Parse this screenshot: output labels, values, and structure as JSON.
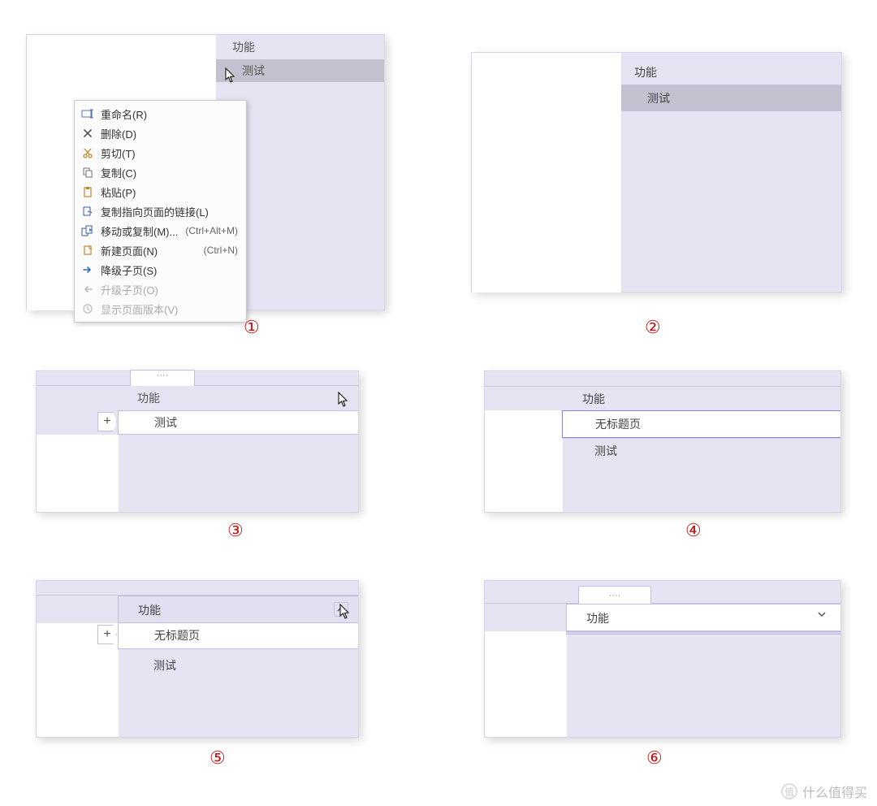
{
  "labels": {
    "section": "功能",
    "test": "测试",
    "untitled_page": "无标题页",
    "tab_partial": "····"
  },
  "context_menu": {
    "rename": "重命名(R)",
    "delete": "删除(D)",
    "cut": "剪切(T)",
    "copy": "复制(C)",
    "paste": "粘贴(P)",
    "copy_link": "复制指向页面的链接(L)",
    "move_copy": "移动或复制(M)...",
    "move_copy_shortcut": "(Ctrl+Alt+M)",
    "new_page": "新建页面(N)",
    "new_page_shortcut": "(Ctrl+N)",
    "demote": "降级子页(S)",
    "promote": "升级子页(O)",
    "show_versions": "显示页面版本(V)"
  },
  "numbers": {
    "n1": "①",
    "n2": "②",
    "n3": "③",
    "n4": "④",
    "n5": "⑤",
    "n6": "⑥"
  },
  "watermark": {
    "icon": "值",
    "text": "什么值得买"
  }
}
